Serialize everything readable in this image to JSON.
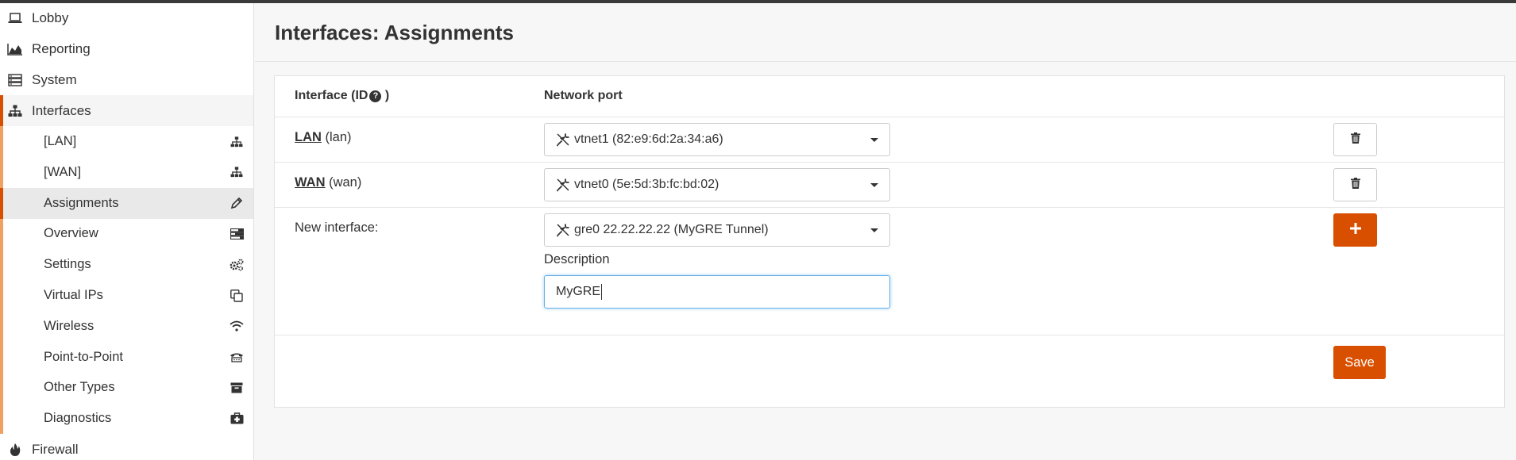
{
  "page": {
    "title": "Interfaces: Assignments"
  },
  "sidebar": {
    "lobby": "Lobby",
    "reporting": "Reporting",
    "system": "System",
    "interfaces": "Interfaces",
    "sub": {
      "lan": "[LAN]",
      "wan": "[WAN]",
      "assignments": "Assignments",
      "overview": "Overview",
      "settings": "Settings",
      "virtual_ips": "Virtual IPs",
      "wireless": "Wireless",
      "ptp": "Point-to-Point",
      "other_types": "Other Types",
      "diagnostics": "Diagnostics"
    },
    "firewall": "Firewall"
  },
  "table": {
    "col_interface": "Interface (ID",
    "col_interface_end": ")",
    "col_port": "Network port",
    "rows": [
      {
        "name": "LAN",
        "id": "(lan)",
        "port": "vtnet1 (82:e9:6d:2a:34:a6)"
      },
      {
        "name": "WAN",
        "id": "(wan)",
        "port": "vtnet0 (5e:5d:3b:fc:bd:02)"
      }
    ],
    "new": {
      "label": "New interface:",
      "port": "gre0 22.22.22.22 (MyGRE Tunnel)",
      "desc_label": "Description",
      "desc_value": "MyGRE"
    },
    "save": "Save"
  },
  "colors": {
    "accent": "#d94f00",
    "sub_bar": "#f0a060"
  }
}
